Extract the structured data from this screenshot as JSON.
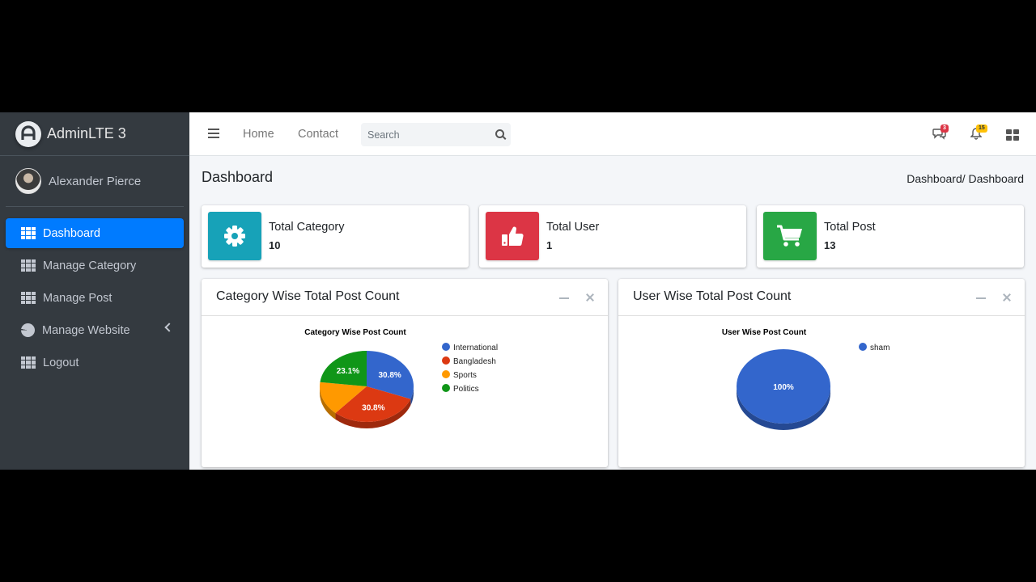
{
  "brand": {
    "name": "AdminLTE 3",
    "logo_icon": "adminlte-logo-icon"
  },
  "user": {
    "name": "Alexander Pierce"
  },
  "sidebar": {
    "items": [
      {
        "label": "Dashboard",
        "icon": "grid-icon",
        "active": true
      },
      {
        "label": "Manage Category",
        "icon": "grid-icon"
      },
      {
        "label": "Manage Post",
        "icon": "grid-icon"
      },
      {
        "label": "Manage Website",
        "icon": "pie-chart-icon",
        "has_submenu": true
      },
      {
        "label": "Logout",
        "icon": "grid-icon"
      }
    ]
  },
  "navbar": {
    "links": [
      "Home",
      "Contact"
    ],
    "search": {
      "placeholder": "Search"
    },
    "messages_badge": "3",
    "notifications_badge": "15"
  },
  "page": {
    "title": "Dashboard",
    "breadcrumb": "Dashboard/ Dashboard"
  },
  "info_boxes": [
    {
      "label": "Total Category",
      "value": "10",
      "icon": "gear-icon",
      "color": "#17a2b8"
    },
    {
      "label": "Total User",
      "value": "1",
      "icon": "thumbs-up-icon",
      "color": "#dc3545"
    },
    {
      "label": "Total Post",
      "value": "13",
      "icon": "shopping-cart-icon",
      "color": "#28a745"
    }
  ],
  "cards": [
    {
      "title": "Category Wise Total Post Count"
    },
    {
      "title": "User Wise Total Post Count"
    }
  ],
  "chart_data": [
    {
      "type": "pie",
      "title": "Category Wise Post Count",
      "categories": [
        "International",
        "Bangladesh",
        "Sports",
        "Politics"
      ],
      "values": [
        4,
        4,
        2,
        3
      ],
      "labels": [
        "30.8%",
        "30.8%",
        "",
        "23.1%"
      ],
      "colors": [
        "#3366cc",
        "#dc3912",
        "#ff9900",
        "#109618"
      ],
      "legend": "right",
      "is3D": true
    },
    {
      "type": "pie",
      "title": "User Wise Post Count",
      "categories": [
        "sham"
      ],
      "values": [
        13
      ],
      "labels": [
        "100%"
      ],
      "colors": [
        "#3366cc"
      ],
      "legend": "right",
      "is3D": true
    }
  ]
}
